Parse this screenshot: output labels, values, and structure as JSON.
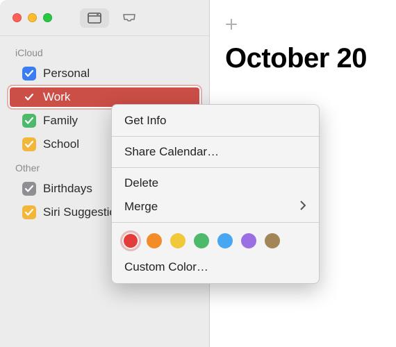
{
  "sidebar": {
    "sections": [
      {
        "title": "iCloud",
        "items": [
          {
            "label": "Personal",
            "color": "#3a7cf1",
            "checked": true,
            "selected": false
          },
          {
            "label": "Work",
            "color": "#cb4e47",
            "checked": true,
            "selected": true
          },
          {
            "label": "Family",
            "color": "#4cba6a",
            "checked": true,
            "selected": false
          },
          {
            "label": "School",
            "color": "#f2b63b",
            "checked": true,
            "selected": false
          }
        ]
      },
      {
        "title": "Other",
        "items": [
          {
            "label": "Birthdays",
            "color": "#8e8e93",
            "checked": true,
            "selected": false
          },
          {
            "label": "Siri Suggestions",
            "color": "#f2b63b",
            "checked": true,
            "selected": false
          }
        ]
      }
    ]
  },
  "main": {
    "month_title": "October 20"
  },
  "context_menu": {
    "get_info": "Get Info",
    "share": "Share Calendar…",
    "delete": "Delete",
    "merge": "Merge",
    "custom_color": "Custom Color…",
    "swatches": [
      {
        "color": "#e23d3a",
        "selected": true
      },
      {
        "color": "#f28c28",
        "selected": false
      },
      {
        "color": "#f2c83b",
        "selected": false
      },
      {
        "color": "#4cba6a",
        "selected": false
      },
      {
        "color": "#47a7f2",
        "selected": false
      },
      {
        "color": "#9a6fe2",
        "selected": false
      },
      {
        "color": "#a38657",
        "selected": false
      }
    ]
  }
}
